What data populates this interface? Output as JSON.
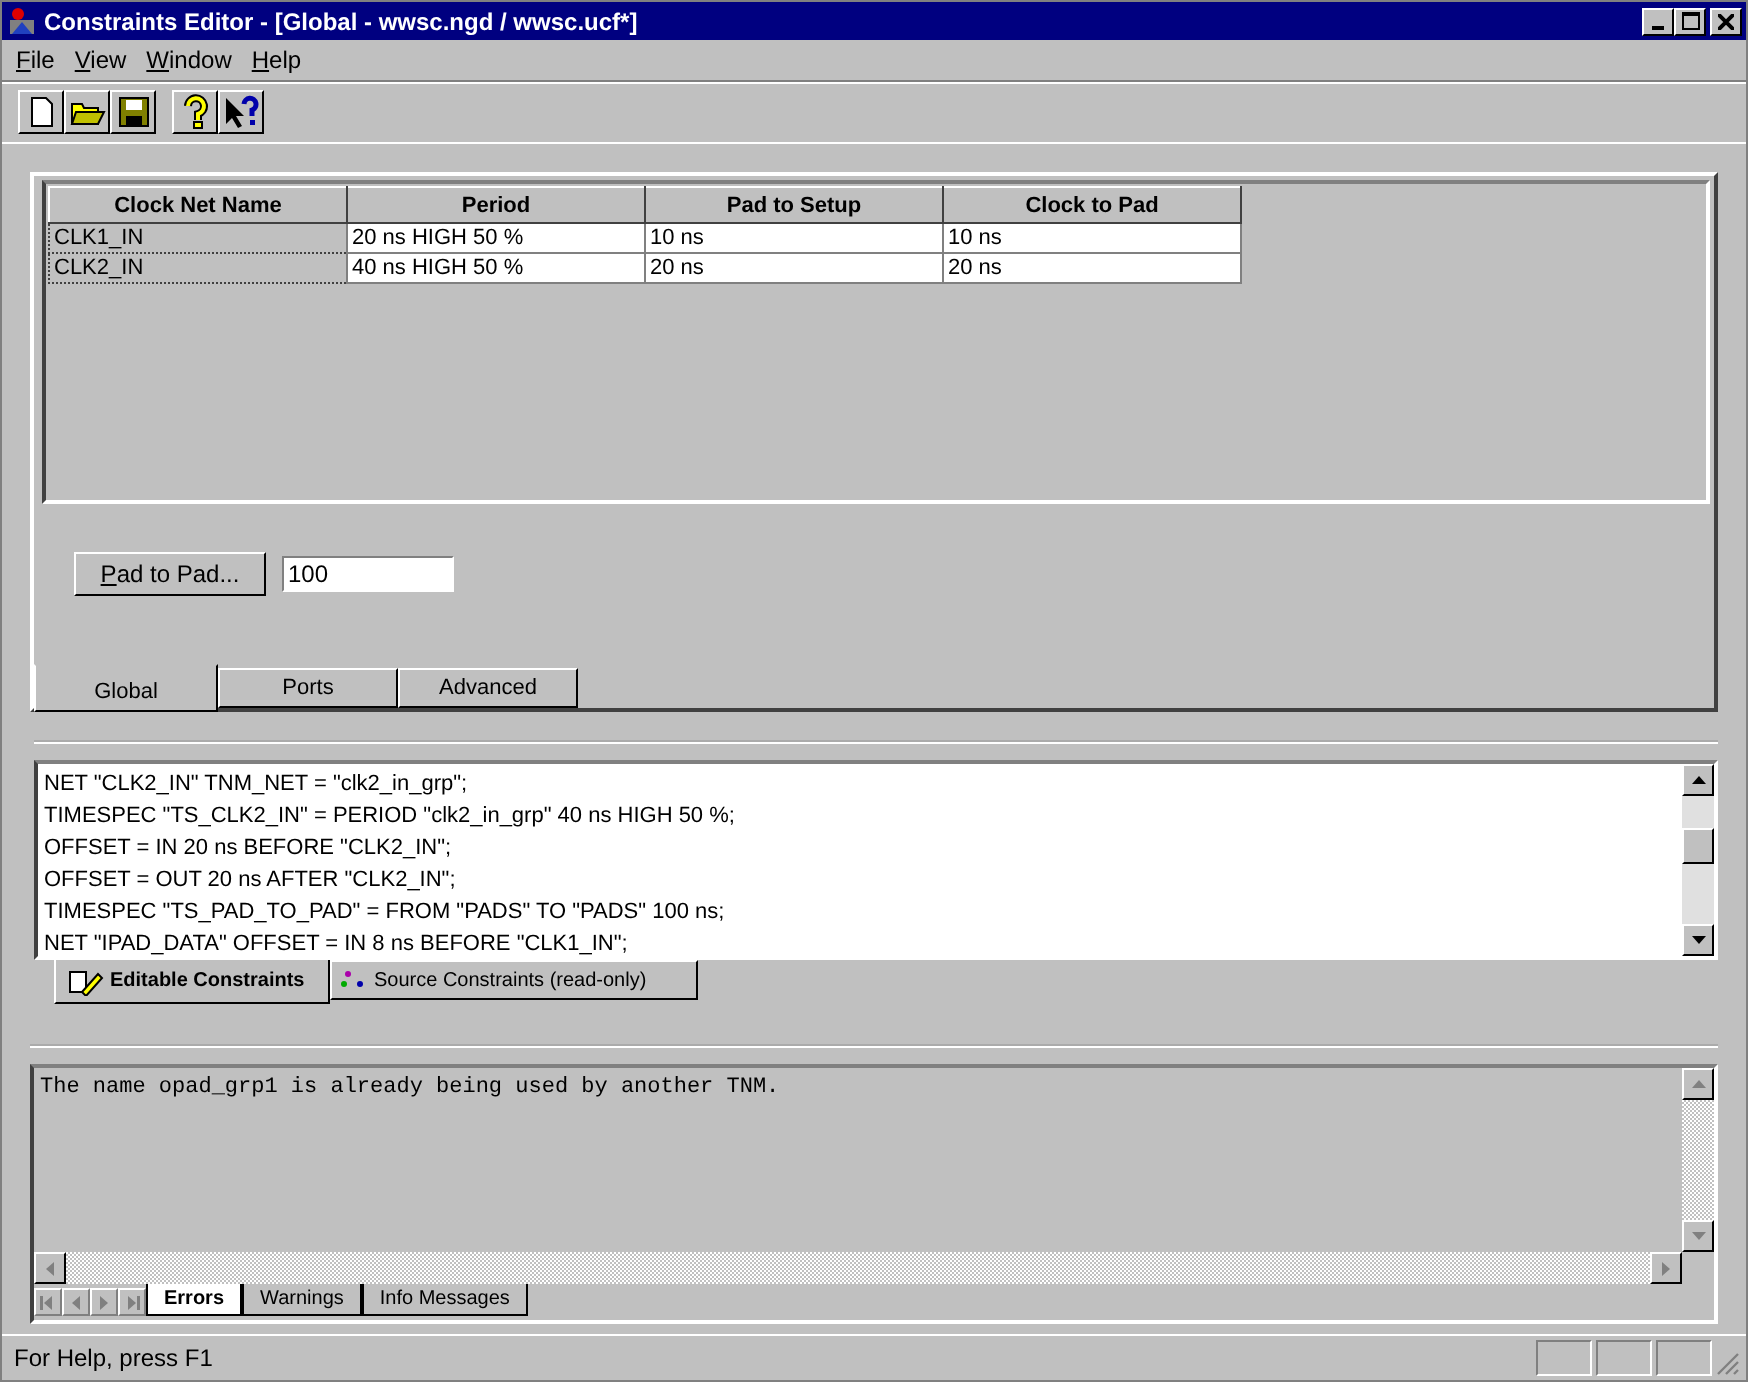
{
  "window": {
    "title": "Constraints Editor - [Global - wwsc.ngd / wwsc.ucf*]"
  },
  "menu": [
    "File",
    "View",
    "Window",
    "Help"
  ],
  "toolbar": [
    {
      "kind": "new"
    },
    {
      "kind": "open"
    },
    {
      "kind": "save"
    },
    {
      "kind": "help"
    },
    {
      "kind": "whatsthis"
    }
  ],
  "table": {
    "columns": [
      "Clock Net Name",
      "Period",
      "Pad to Setup",
      "Clock to Pad"
    ],
    "rows": [
      [
        "CLK1_IN",
        "20 ns HIGH 50 %",
        "10 ns",
        "10 ns"
      ],
      [
        "CLK2_IN",
        "40 ns HIGH 50 %",
        "20 ns",
        "20 ns"
      ]
    ]
  },
  "pad_to_pad": {
    "button": "Pad to Pad...",
    "value": "100"
  },
  "view_tabs": [
    {
      "label": "Global",
      "selected": true
    },
    {
      "label": "Ports",
      "selected": false
    },
    {
      "label": "Advanced",
      "selected": false
    }
  ],
  "constraints": [
    "NET \"CLK2_IN\" TNM_NET = \"clk2_in_grp\";",
    "TIMESPEC \"TS_CLK2_IN\" = PERIOD \"clk2_in_grp\" 40 ns HIGH 50 %;",
    "OFFSET = IN 20 ns BEFORE \"CLK2_IN\";",
    "OFFSET = OUT 20 ns AFTER \"CLK2_IN\";",
    "TIMESPEC \"TS_PAD_TO_PAD\" = FROM \"PADS\" TO \"PADS\" 100 ns;",
    "NET \"IPAD_DATA\" OFFSET = IN 8 ns BEFORE \"CLK1_IN\";"
  ],
  "constraint_tabs": [
    {
      "label": "Editable Constraints",
      "selected": true
    },
    {
      "label": "Source Constraints (read-only)",
      "selected": false
    }
  ],
  "messages": [
    "The name opad_grp1 is already being used by another TNM."
  ],
  "message_tabs": [
    {
      "label": "Errors",
      "selected": true
    },
    {
      "label": "Warnings",
      "selected": false
    },
    {
      "label": "Info Messages",
      "selected": false
    }
  ],
  "status_bar": "For Help, press F1"
}
